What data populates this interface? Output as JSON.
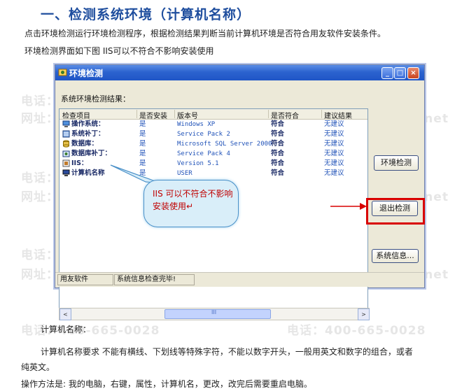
{
  "heading": "一、检测系统环境（计算机名称）",
  "intro_line1": "点击环境检测运行环境检测程序，根据检测结果判断当前计算机环境是否符合用友软件安装条件。",
  "intro_line2": "环境检测界面如下图 IIS可以不符合不影响安装使用",
  "window": {
    "title": "环境检测",
    "controls": {
      "minimize": "_",
      "maximize": "□",
      "close": "×"
    },
    "group_label": "系统环境检测结果：",
    "columns": [
      "检查项目",
      "是否安装",
      "版本号",
      "是否符合",
      "建议结果"
    ],
    "rows": [
      {
        "item": "操作系统：",
        "installed": "是",
        "version": "Windows XP",
        "match": "符合",
        "advice": "无建议"
      },
      {
        "item": "系统补丁：",
        "installed": "是",
        "version": "Service Pack 2",
        "match": "符合",
        "advice": "无建议"
      },
      {
        "item": "数据库：",
        "installed": "是",
        "version": "Microsoft SQL Server 2000",
        "match": "符合",
        "advice": "无建议"
      },
      {
        "item": "数据库补丁：",
        "installed": "是",
        "version": "Service Pack 4",
        "match": "符合",
        "advice": "无建议"
      },
      {
        "item": "IIS：",
        "installed": "是",
        "version": "Version 5.1",
        "match": "符合",
        "advice": "无建议"
      },
      {
        "item": "计算机名称",
        "installed": "是",
        "version": "USER",
        "match": "符合",
        "advice": "无建议"
      }
    ],
    "buttons": {
      "env_check": "环境检测",
      "exit_check": "退出检测",
      "system_info": "系统信息..."
    },
    "status": {
      "left": "用友软件",
      "right": "系统信息检查完毕!"
    },
    "scroll": {
      "left": "<",
      "mid": "III",
      "right": ">"
    }
  },
  "callout_text": "IIS 可以不符合不影响安装使用↵",
  "computer_name_label": "计算机名称：",
  "req_line1": "计算机名称要求 不能有横线、下划线等特殊字符，不能以数字开头，一般用英文和数字的组合，或者",
  "req_line2": "纯英文。",
  "method_line": "操作方法是: 我的电脑，右键，属性，计算机名，更改，改完后需要重启电脑。",
  "watermark": {
    "phone": "电话：400-665-0028",
    "web": "网址：www.chanjet.net"
  },
  "colors": {
    "heading": "#1f4e9e",
    "callout_border": "#4a90c8",
    "highlight": "#d80000",
    "callout_text": "#c00000"
  }
}
